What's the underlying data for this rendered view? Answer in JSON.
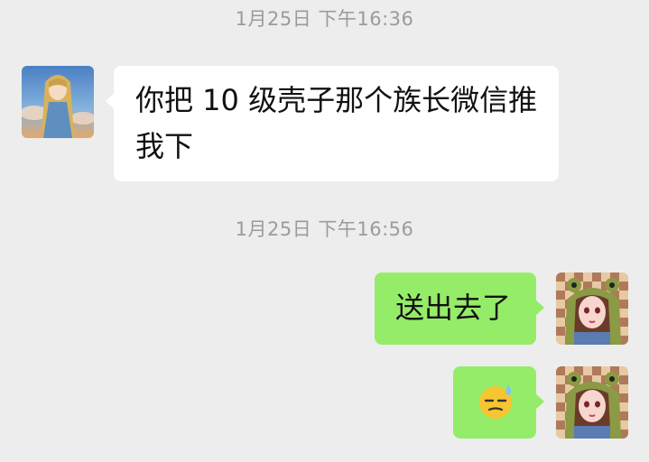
{
  "timestamps": [
    "1月25日 下午16:36",
    "1月25日 下午16:56"
  ],
  "messages": [
    {
      "direction": "incoming",
      "text": "你把 10 级壳子那个族长微信推我下",
      "avatar_icon": "anime-girl-sky-avatar"
    },
    {
      "direction": "outgoing",
      "text": "送出去了",
      "avatar_icon": "frog-hood-girl-avatar"
    },
    {
      "direction": "outgoing",
      "emoji": "sweat-face-emoji",
      "avatar_icon": "frog-hood-girl-avatar"
    }
  ],
  "colors": {
    "background": "#ededed",
    "incoming_bubble": "#ffffff",
    "outgoing_bubble": "#95ec69",
    "timestamp_text": "#9b9b9b"
  }
}
